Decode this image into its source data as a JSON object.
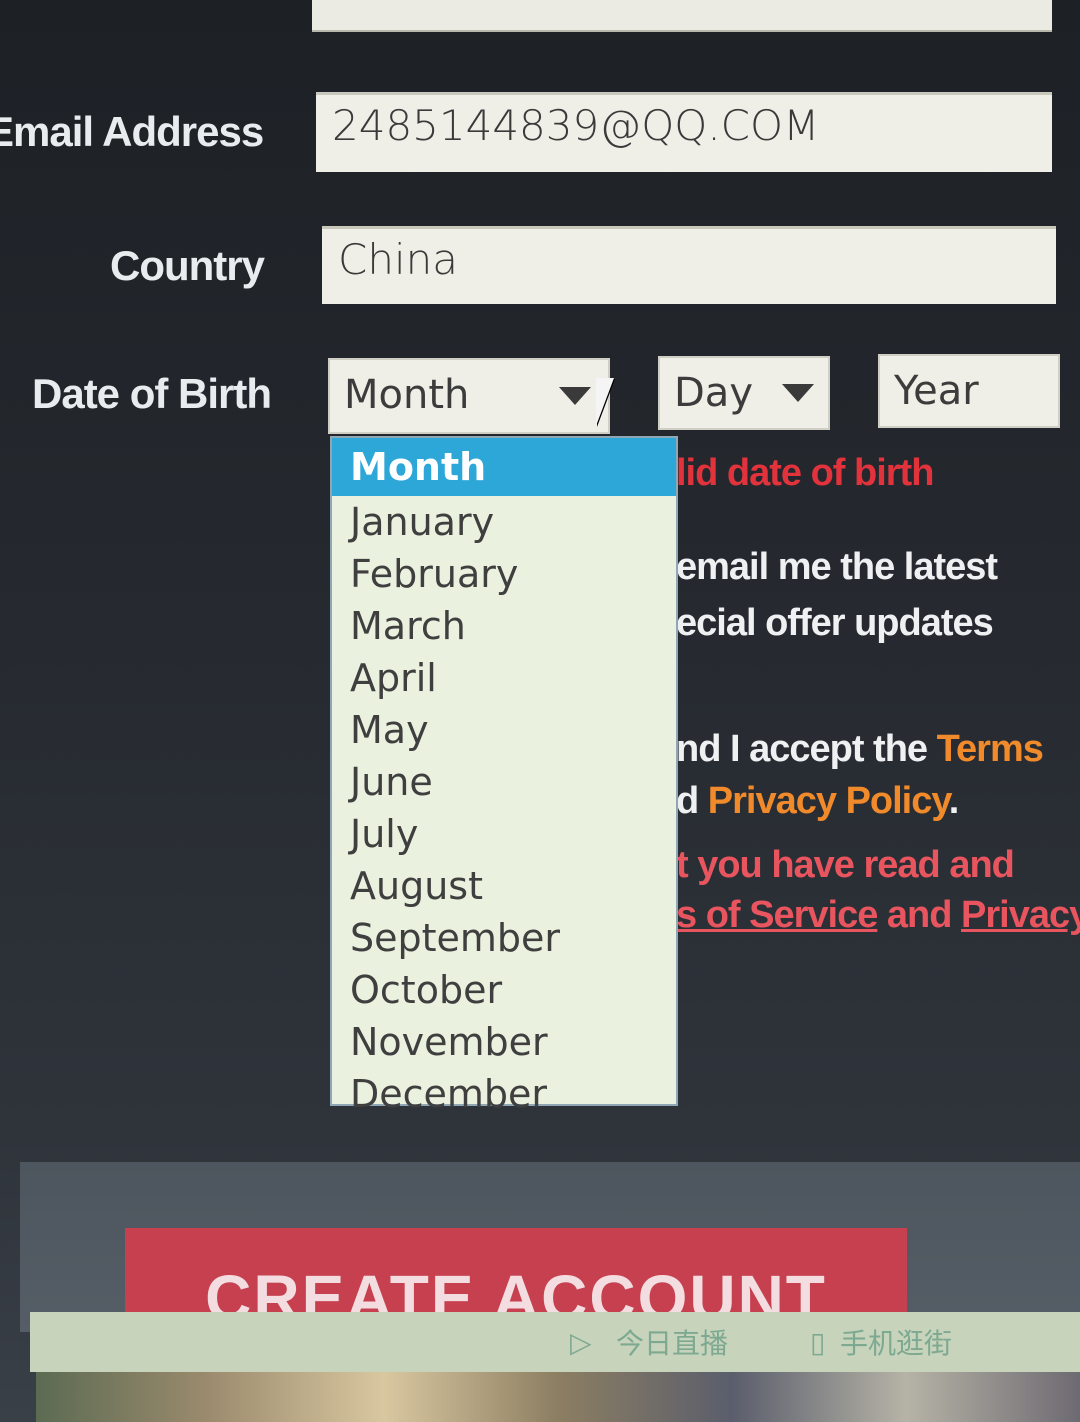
{
  "form": {
    "email_label": "Email Address",
    "email_value": "2485144839@QQ.COM",
    "country_label": "Country",
    "country_value": "China",
    "dob_label": "Date of Birth",
    "month_select": "Month",
    "day_select": "Day",
    "year_placeholder": "Year"
  },
  "month_dropdown": {
    "options": [
      "Month",
      "January",
      "February",
      "March",
      "April",
      "May",
      "June",
      "July",
      "August",
      "September",
      "October",
      "November",
      "December"
    ],
    "selected_index": 0
  },
  "messages": {
    "dob_error": "lid date of birth",
    "newsletter_line1": "email me the latest",
    "newsletter_line2": "ecial offer updates",
    "accept_line1_pre": "nd I accept the ",
    "accept_terms": "Terms",
    "accept_line2_pre": "d ",
    "accept_privacy": "Privacy Policy",
    "accept_line2_post": ".",
    "terms_error_line1": "t you have read and",
    "terms_error_tos": "s of Service",
    "terms_error_and": " and ",
    "terms_error_privacy": "Privacy"
  },
  "button": {
    "create_account": "CREATE ACCOUNT"
  },
  "taskbar": {
    "item1": "今日直播",
    "item2": "手机逛街"
  },
  "colors": {
    "error": "#e2333d",
    "link": "#f08a2a",
    "highlight": "#2ca7d8",
    "button": "#c7404f"
  }
}
